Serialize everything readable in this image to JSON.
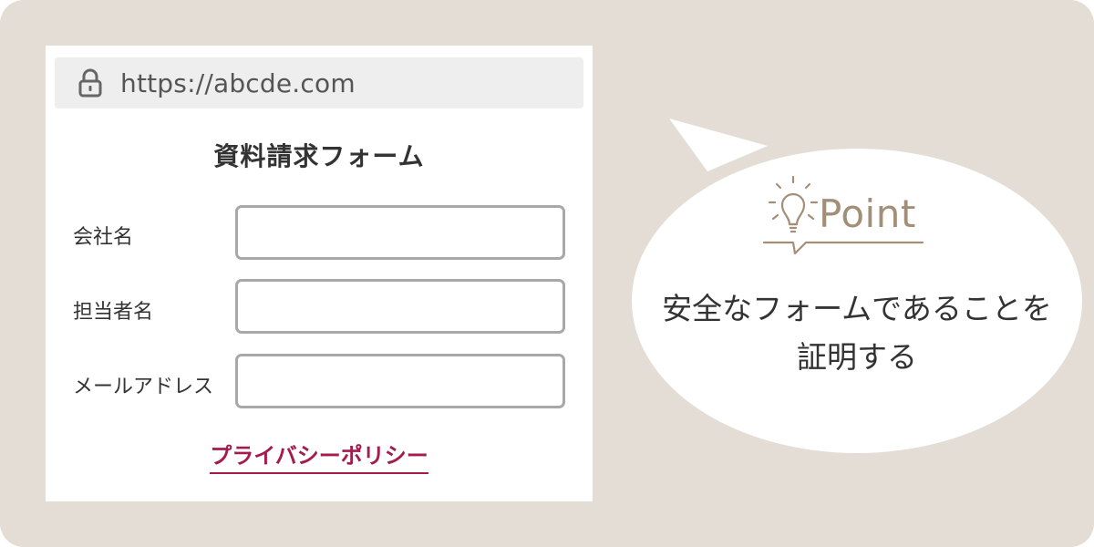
{
  "browser": {
    "url": "https://abcde.com",
    "lock_icon": "lock-icon"
  },
  "form": {
    "title": "資料請求フォーム",
    "fields": [
      {
        "label": "会社名",
        "value": ""
      },
      {
        "label": "担当者名",
        "value": ""
      },
      {
        "label": "メールアドレス",
        "value": ""
      }
    ],
    "privacy_link": "プライバシーポリシー"
  },
  "callout": {
    "badge_label": "Point",
    "badge_icon": "lightbulb-icon",
    "text_line1": "安全なフォームであることを",
    "text_line2": "証明する"
  },
  "colors": {
    "background": "#e3ddd6",
    "accent": "#a38f77",
    "link": "#a41b4d"
  }
}
